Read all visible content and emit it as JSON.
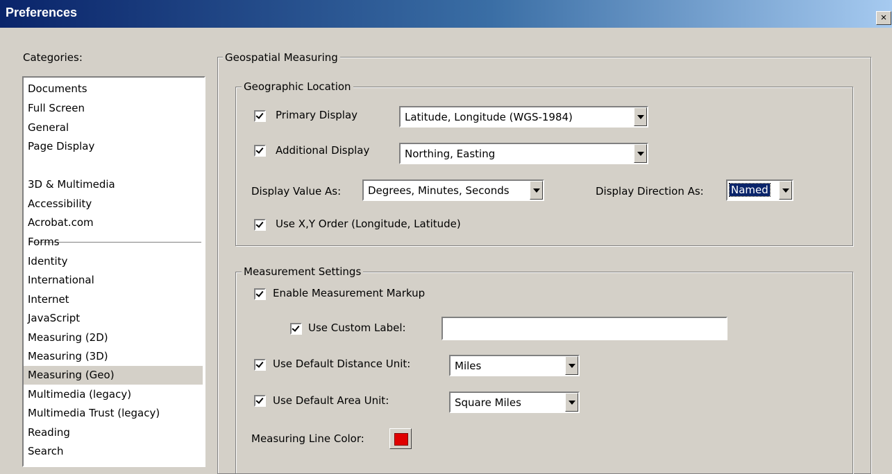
{
  "window": {
    "title": "Preferences",
    "close_label": "×"
  },
  "categories": {
    "label": "Categories:",
    "items": [
      {
        "label": "Documents"
      },
      {
        "label": "Full Screen"
      },
      {
        "label": "General"
      },
      {
        "label": "Page Display"
      },
      {
        "label": "3D & Multimedia"
      },
      {
        "label": "Accessibility"
      },
      {
        "label": "Acrobat.com"
      },
      {
        "label": "Forms"
      },
      {
        "label": "Identity"
      },
      {
        "label": "International"
      },
      {
        "label": "Internet"
      },
      {
        "label": "JavaScript"
      },
      {
        "label": "Measuring (2D)"
      },
      {
        "label": "Measuring (3D)"
      },
      {
        "label": "Measuring (Geo)"
      },
      {
        "label": "Multimedia (legacy)"
      },
      {
        "label": "Multimedia Trust (legacy)"
      },
      {
        "label": "Reading"
      },
      {
        "label": "Search"
      }
    ],
    "selected": "Measuring (Geo)"
  },
  "geo": {
    "title": "Geospatial Measuring",
    "location": {
      "title": "Geographic Location",
      "primary_label": "Primary Display",
      "primary_checked": true,
      "primary_value": "Latitude, Longitude (WGS-1984)",
      "additional_label": "Additional Display",
      "additional_checked": true,
      "additional_value": "Northing, Easting",
      "value_as_label": "Display Value As:",
      "value_as": "Degrees, Minutes, Seconds",
      "direction_label": "Display Direction As:",
      "direction": "Named",
      "xy_label": "Use X,Y Order (Longitude, Latitude)",
      "xy_checked": true
    },
    "measurement": {
      "title": "Measurement Settings",
      "markup_label": "Enable Measurement Markup",
      "markup_checked": true,
      "custom_label": "Use Custom Label:",
      "custom_checked": true,
      "custom_value": "",
      "distance_label": "Use Default Distance Unit:",
      "distance_checked": true,
      "distance_value": "Miles",
      "area_label": "Use Default Area Unit:",
      "area_checked": true,
      "area_value": "Square Miles",
      "line_color_label": "Measuring Line Color:",
      "line_color": "#e00000"
    }
  }
}
